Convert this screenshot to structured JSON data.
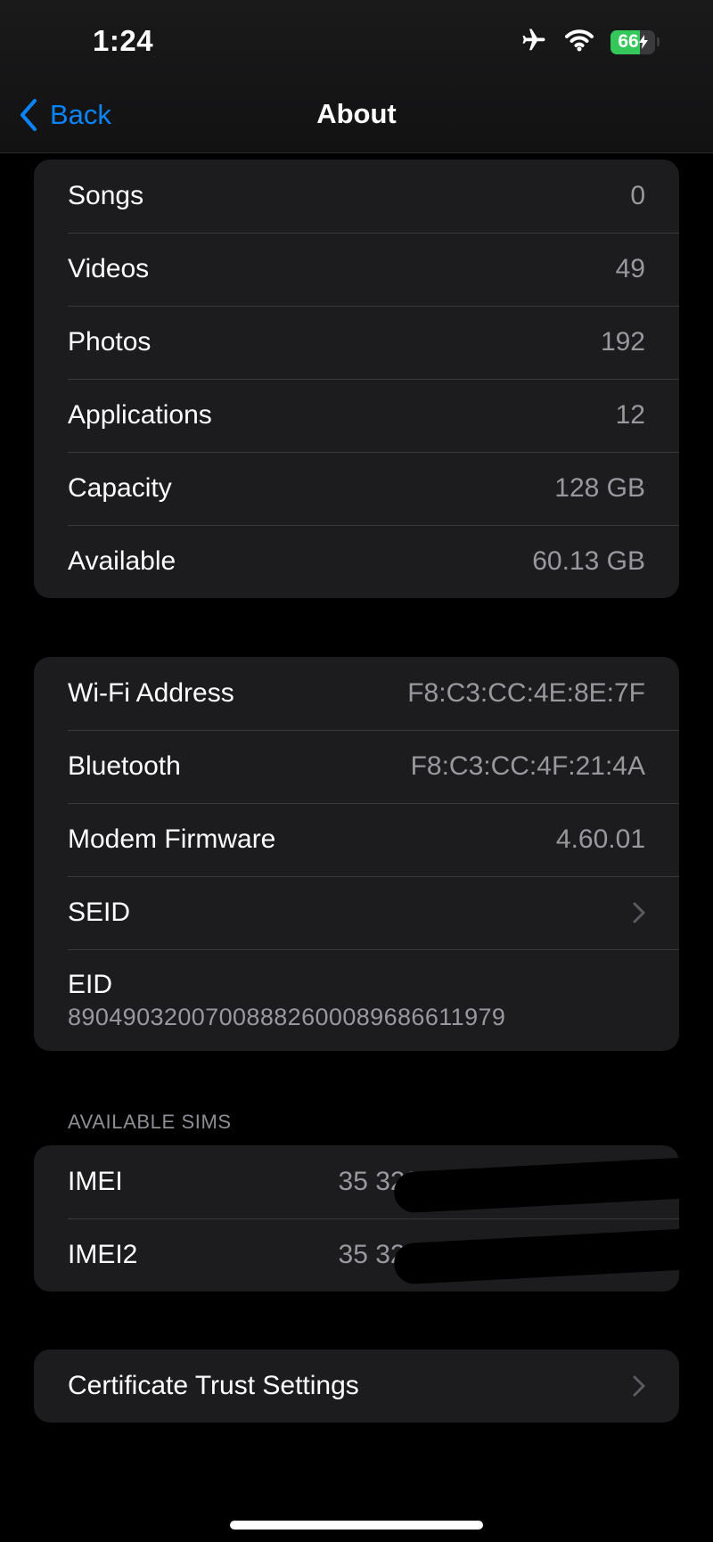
{
  "status_bar": {
    "time": "1:24",
    "battery_percent": "66",
    "battery_level": 0.66,
    "icons": [
      "airplane-icon",
      "wifi-icon",
      "battery-charging-icon"
    ]
  },
  "nav": {
    "back_label": "Back",
    "title": "About"
  },
  "media_group": [
    {
      "label": "Songs",
      "value": "0"
    },
    {
      "label": "Videos",
      "value": "49"
    },
    {
      "label": "Photos",
      "value": "192"
    },
    {
      "label": "Applications",
      "value": "12"
    },
    {
      "label": "Capacity",
      "value": "128 GB"
    },
    {
      "label": "Available",
      "value": "60.13 GB"
    }
  ],
  "network_group": {
    "wifi_label": "Wi-Fi Address",
    "wifi_value": "F8:C3:CC:4E:8E:7F",
    "bluetooth_label": "Bluetooth",
    "bluetooth_value": "F8:C3:CC:4F:21:4A",
    "modem_label": "Modem Firmware",
    "modem_value": "4.60.01",
    "seid_label": "SEID",
    "eid_label": "EID",
    "eid_value": "89049032007008882600089686611979"
  },
  "sims": {
    "section_title": "AVAILABLE SIMS",
    "imei_label": "IMEI",
    "imei_value": "35 3281",
    "imei2_label": "IMEI2",
    "imei2_value": "35 3281"
  },
  "certificate": {
    "label": "Certificate Trust Settings"
  },
  "colors": {
    "accent": "#0a84ff",
    "background": "#000000",
    "group_background": "#1c1c1e",
    "secondary_text": "#98989f",
    "battery": "#34c759"
  }
}
